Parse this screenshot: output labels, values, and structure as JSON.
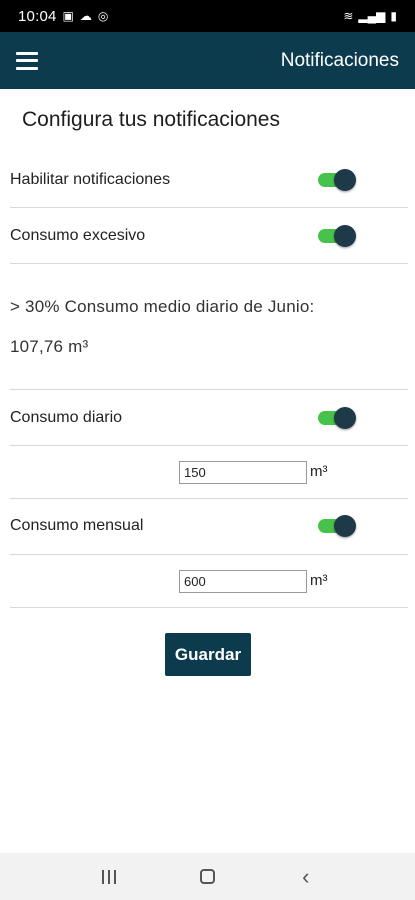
{
  "status_bar": {
    "time": "10:04",
    "left_icons": [
      "image-icon",
      "cloud-icon",
      "sync-icon"
    ],
    "right_icons": [
      "wifi-icon",
      "signal-icon",
      "battery-icon"
    ]
  },
  "app_bar": {
    "menu_icon": "hamburger-menu-icon",
    "title": "Notificaciones"
  },
  "page": {
    "heading": "Configura tus notificaciones"
  },
  "settings": {
    "enable_notifications": {
      "label": "Habilitar notificaciones",
      "enabled": true
    },
    "excess_consumption": {
      "label": "Consumo excesivo",
      "enabled": true
    },
    "info_line1": "> 30% Consumo medio diario de Junio:",
    "info_line2": "107,76 m³",
    "daily_consumption": {
      "label": "Consumo diario",
      "enabled": true,
      "value": "150",
      "unit": "m³"
    },
    "monthly_consumption": {
      "label": "Consumo mensual",
      "enabled": true,
      "value": "600",
      "unit": "m³"
    }
  },
  "actions": {
    "save_label": "Guardar"
  },
  "nav_bar": {
    "icons": [
      "recents-icon",
      "home-icon",
      "back-icon"
    ]
  },
  "colors": {
    "primary": "#0d3b4e",
    "toggle_on": "#47c24a",
    "knob": "#1e3a48"
  }
}
